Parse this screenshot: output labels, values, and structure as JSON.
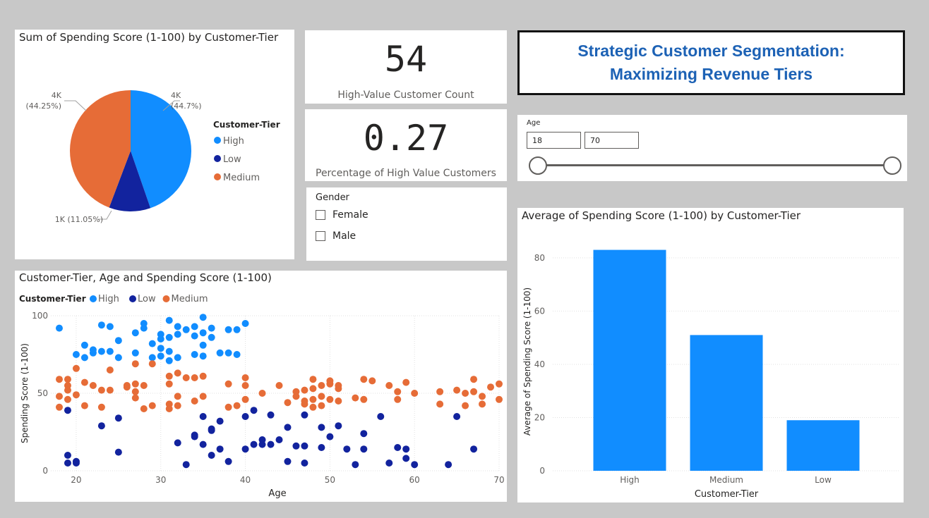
{
  "pie": {
    "title": "Sum of Spending Score (1-100) by Customer-Tier",
    "legend_title": "Customer-Tier",
    "labels": {
      "high_line1": "4K",
      "high_line2": "(44.7%)",
      "medium_line1": "4K",
      "medium_line2": "(44.25%)",
      "low": "1K (11.05%)"
    }
  },
  "kpi1": {
    "value": "54",
    "label": "High-Value Customer Count"
  },
  "kpi2": {
    "value": "0.27",
    "label": "Percentage of High Value Customers"
  },
  "gender_slicer": {
    "title": "Gender",
    "options": [
      "Female",
      "Male"
    ]
  },
  "title_box": {
    "line1": "Strategic Customer Segmentation:",
    "line2": "Maximizing Revenue Tiers"
  },
  "age_slicer": {
    "title": "Age",
    "min": "18",
    "max": "70",
    "range": [
      18,
      70
    ]
  },
  "scatter": {
    "title": "Customer-Tier, Age and Spending Score (1-100)",
    "legend_title": "Customer-Tier",
    "xlabel": "Age",
    "ylabel": "Spending Score (1-100)",
    "xticks": [
      "20",
      "30",
      "40",
      "50",
      "60",
      "70"
    ],
    "yticks": [
      "0",
      "50",
      "100"
    ]
  },
  "bar": {
    "title": "Average of Spending Score (1-100) by Customer-Tier",
    "xlabel": "Customer-Tier",
    "ylabel": "Average of Spending Score (1-100)",
    "yticks": [
      "0",
      "20",
      "40",
      "60",
      "80"
    ]
  },
  "colors": {
    "high": "#118dff",
    "low": "#12239e",
    "medium": "#e66c37"
  },
  "chart_data": [
    {
      "type": "pie",
      "title": "Sum of Spending Score (1-100) by Customer-Tier",
      "legend": [
        "High",
        "Low",
        "Medium"
      ],
      "slices": [
        {
          "label": "High",
          "value": 4,
          "percent": 44.7,
          "display": "4K"
        },
        {
          "label": "Low",
          "value": 1,
          "percent": 11.05,
          "display": "1K"
        },
        {
          "label": "Medium",
          "value": 4,
          "percent": 44.25,
          "display": "4K"
        }
      ]
    },
    {
      "type": "scatter",
      "title": "Customer-Tier, Age and Spending Score (1-100)",
      "xlabel": "Age",
      "ylabel": "Spending Score (1-100)",
      "xlim": [
        17,
        70
      ],
      "ylim": [
        0,
        100
      ],
      "legend": "top-left",
      "series": [
        {
          "name": "High",
          "points": [
            [
              18,
              92
            ],
            [
              20,
              75
            ],
            [
              21,
              81
            ],
            [
              21,
              73
            ],
            [
              22,
              76
            ],
            [
              22,
              78
            ],
            [
              23,
              94
            ],
            [
              23,
              77
            ],
            [
              24,
              93
            ],
            [
              24,
              77
            ],
            [
              25,
              73
            ],
            [
              25,
              84
            ],
            [
              27,
              76
            ],
            [
              27,
              89
            ],
            [
              28,
              92
            ],
            [
              28,
              95
            ],
            [
              29,
              82
            ],
            [
              29,
              73
            ],
            [
              30,
              88
            ],
            [
              30,
              85
            ],
            [
              30,
              79
            ],
            [
              30,
              74
            ],
            [
              31,
              97
            ],
            [
              31,
              86
            ],
            [
              31,
              77
            ],
            [
              31,
              71
            ],
            [
              32,
              93
            ],
            [
              32,
              88
            ],
            [
              32,
              73
            ],
            [
              33,
              91
            ],
            [
              34,
              93
            ],
            [
              34,
              87
            ],
            [
              34,
              75
            ],
            [
              35,
              99
            ],
            [
              35,
              89
            ],
            [
              35,
              81
            ],
            [
              35,
              74
            ],
            [
              36,
              86
            ],
            [
              36,
              92
            ],
            [
              37,
              76
            ],
            [
              38,
              91
            ],
            [
              38,
              76
            ],
            [
              39,
              91
            ],
            [
              39,
              75
            ],
            [
              40,
              95
            ]
          ]
        },
        {
          "name": "Low",
          "points": [
            [
              19,
              39
            ],
            [
              19,
              10
            ],
            [
              19,
              5
            ],
            [
              20,
              6
            ],
            [
              20,
              5
            ],
            [
              23,
              29
            ],
            [
              25,
              12
            ],
            [
              25,
              34
            ],
            [
              32,
              18
            ],
            [
              33,
              4
            ],
            [
              34,
              22
            ],
            [
              34,
              23
            ],
            [
              35,
              35
            ],
            [
              35,
              17
            ],
            [
              36,
              26
            ],
            [
              36,
              27
            ],
            [
              36,
              10
            ],
            [
              37,
              14
            ],
            [
              37,
              32
            ],
            [
              38,
              6
            ],
            [
              40,
              35
            ],
            [
              40,
              14
            ],
            [
              41,
              39
            ],
            [
              41,
              17
            ],
            [
              42,
              20
            ],
            [
              42,
              17
            ],
            [
              43,
              36
            ],
            [
              43,
              17
            ],
            [
              44,
              20
            ],
            [
              45,
              28
            ],
            [
              45,
              6
            ],
            [
              46,
              16
            ],
            [
              47,
              16
            ],
            [
              47,
              5
            ],
            [
              47,
              36
            ],
            [
              49,
              28
            ],
            [
              49,
              15
            ],
            [
              50,
              22
            ],
            [
              51,
              29
            ],
            [
              52,
              14
            ],
            [
              53,
              4
            ],
            [
              54,
              24
            ],
            [
              54,
              14
            ],
            [
              56,
              35
            ],
            [
              57,
              5
            ],
            [
              58,
              15
            ],
            [
              59,
              14
            ],
            [
              59,
              8
            ],
            [
              60,
              4
            ],
            [
              64,
              4
            ],
            [
              65,
              35
            ],
            [
              67,
              14
            ]
          ]
        },
        {
          "name": "Medium",
          "points": [
            [
              18,
              41
            ],
            [
              18,
              48
            ],
            [
              18,
              59
            ],
            [
              19,
              52
            ],
            [
              19,
              55
            ],
            [
              19,
              59
            ],
            [
              19,
              46
            ],
            [
              20,
              49
            ],
            [
              20,
              66
            ],
            [
              21,
              42
            ],
            [
              21,
              57
            ],
            [
              22,
              55
            ],
            [
              23,
              52
            ],
            [
              23,
              41
            ],
            [
              24,
              52
            ],
            [
              24,
              65
            ],
            [
              26,
              54
            ],
            [
              26,
              55
            ],
            [
              27,
              47
            ],
            [
              27,
              51
            ],
            [
              27,
              56
            ],
            [
              27,
              69
            ],
            [
              28,
              40
            ],
            [
              28,
              55
            ],
            [
              29,
              42
            ],
            [
              29,
              69
            ],
            [
              31,
              43
            ],
            [
              31,
              56
            ],
            [
              31,
              61
            ],
            [
              31,
              40
            ],
            [
              32,
              63
            ],
            [
              32,
              48
            ],
            [
              32,
              42
            ],
            [
              33,
              60
            ],
            [
              34,
              60
            ],
            [
              34,
              45
            ],
            [
              35,
              48
            ],
            [
              35,
              61
            ],
            [
              38,
              56
            ],
            [
              38,
              41
            ],
            [
              39,
              42
            ],
            [
              40,
              60
            ],
            [
              40,
              55
            ],
            [
              40,
              46
            ],
            [
              42,
              50
            ],
            [
              44,
              55
            ],
            [
              45,
              44
            ],
            [
              46,
              48
            ],
            [
              46,
              51
            ],
            [
              47,
              43
            ],
            [
              47,
              45
            ],
            [
              47,
              52
            ],
            [
              48,
              46
            ],
            [
              48,
              41
            ],
            [
              48,
              53
            ],
            [
              48,
              59
            ],
            [
              49,
              48
            ],
            [
              49,
              55
            ],
            [
              49,
              42
            ],
            [
              50,
              56
            ],
            [
              50,
              58
            ],
            [
              50,
              46
            ],
            [
              51,
              53
            ],
            [
              51,
              55
            ],
            [
              51,
              45
            ],
            [
              53,
              47
            ],
            [
              54,
              46
            ],
            [
              54,
              59
            ],
            [
              55,
              58
            ],
            [
              57,
              55
            ],
            [
              58,
              51
            ],
            [
              58,
              46
            ],
            [
              59,
              57
            ],
            [
              60,
              50
            ],
            [
              63,
              51
            ],
            [
              63,
              43
            ],
            [
              65,
              52
            ],
            [
              66,
              42
            ],
            [
              66,
              50
            ],
            [
              67,
              51
            ],
            [
              67,
              59
            ],
            [
              68,
              48
            ],
            [
              68,
              43
            ],
            [
              69,
              54
            ],
            [
              70,
              46
            ],
            [
              70,
              56
            ]
          ]
        }
      ]
    },
    {
      "type": "bar",
      "title": "Average of Spending Score (1-100) by Customer-Tier",
      "xlabel": "Customer-Tier",
      "ylabel": "Average of Spending Score (1-100)",
      "categories": [
        "High",
        "Medium",
        "Low"
      ],
      "values": [
        83,
        51,
        19
      ],
      "ylim": [
        0,
        85
      ]
    }
  ]
}
